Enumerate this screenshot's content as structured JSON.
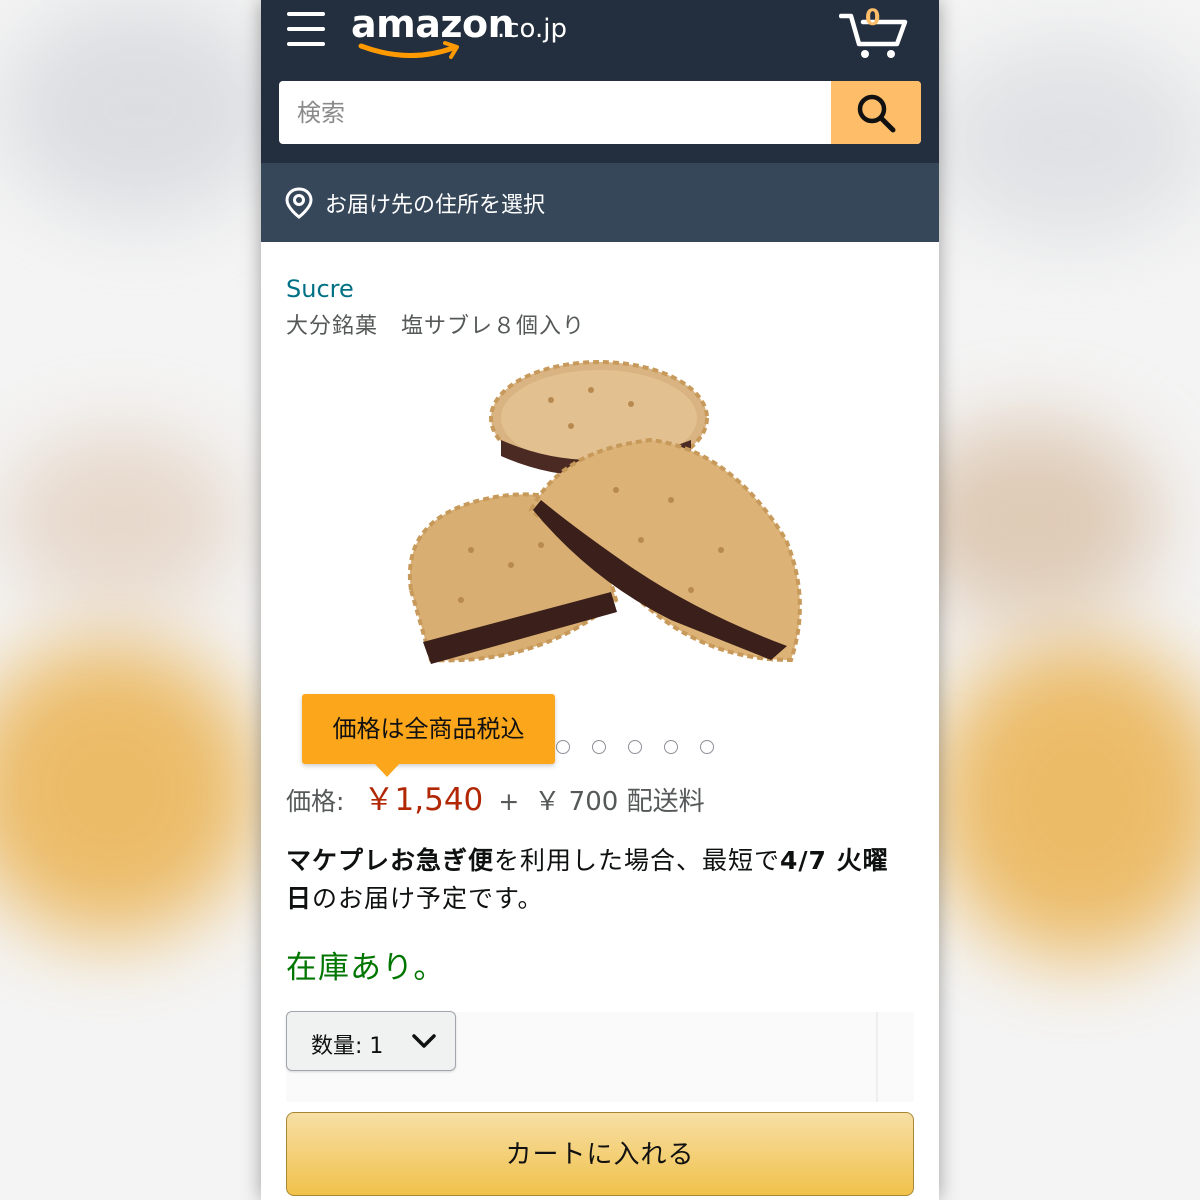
{
  "header": {
    "logo_text": "amazon",
    "logo_tld": ".co.jp",
    "cart_count": "0",
    "search_placeholder": "検索"
  },
  "location": {
    "label": "お届け先の住所を選択"
  },
  "product": {
    "brand": "Sucre",
    "title": "大分銘菓　塩サブレ８個入り",
    "image_count": 7,
    "tooltip": "価格は全商品税込",
    "price_label": "価格:",
    "price": "￥1,540",
    "plus": "+",
    "shipping": "￥ 700 配送料",
    "delivery_bold_1": "マケプレお急ぎ便",
    "delivery_text_1": "を利用した場合、最短で",
    "delivery_bold_2": "4/7 火曜日",
    "delivery_text_2": "のお届け予定です。",
    "stock": "在庫あり。",
    "quantity_label": "数量: 1",
    "add_to_cart": "カートに入れる"
  },
  "colors": {
    "nav": "#232f3e",
    "location_bar": "#37475a",
    "search_button": "#febd69",
    "price": "#b12704",
    "stock": "#007600",
    "brand_link": "#007185",
    "tooltip": "#fba61b"
  }
}
